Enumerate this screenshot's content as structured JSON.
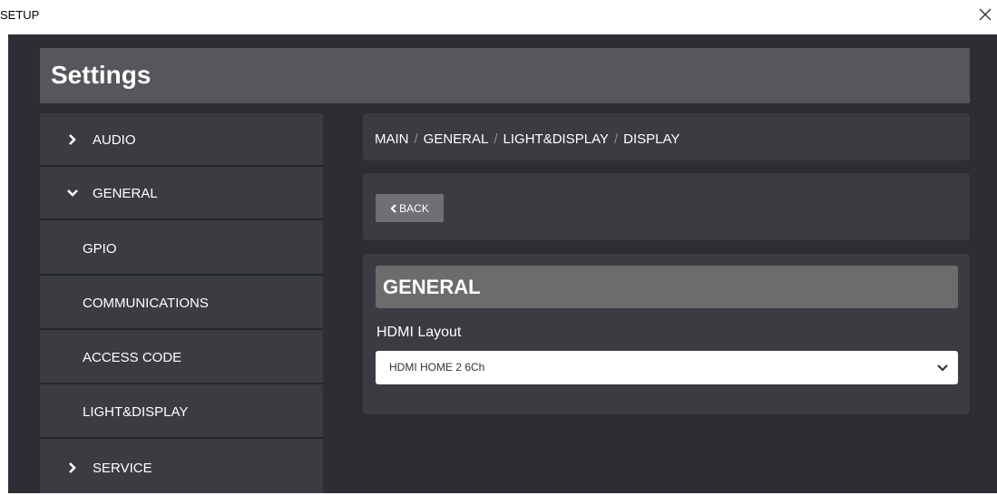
{
  "window": {
    "title": "SETUP",
    "close_icon": "close-icon"
  },
  "header": {
    "title": "Settings"
  },
  "sidebar": {
    "items": [
      {
        "label": "AUDIO",
        "icon": "chevron-right-icon"
      },
      {
        "label": "GENERAL",
        "icon": "chevron-down-icon"
      },
      {
        "label": "GPIO"
      },
      {
        "label": "COMMUNICATIONS"
      },
      {
        "label": "ACCESS CODE"
      },
      {
        "label": "LIGHT&DISPLAY"
      },
      {
        "label": "SERVICE",
        "icon": "chevron-right-icon"
      }
    ]
  },
  "breadcrumb": {
    "items": [
      "MAIN",
      "GENERAL",
      "LIGHT&DISPLAY",
      "DISPLAY"
    ],
    "separator": "/"
  },
  "back_button": {
    "label": "BACK",
    "icon": "chevron-left-icon"
  },
  "section": {
    "title": "GENERAL",
    "field_label": "HDMI Layout",
    "select_value": "HDMI HOME 2 6Ch"
  },
  "colors": {
    "background": "#2c2e33",
    "panel": "#3a3c42",
    "header": "#55575b",
    "section_header": "#6c6c6c",
    "button": "#6e7075"
  }
}
